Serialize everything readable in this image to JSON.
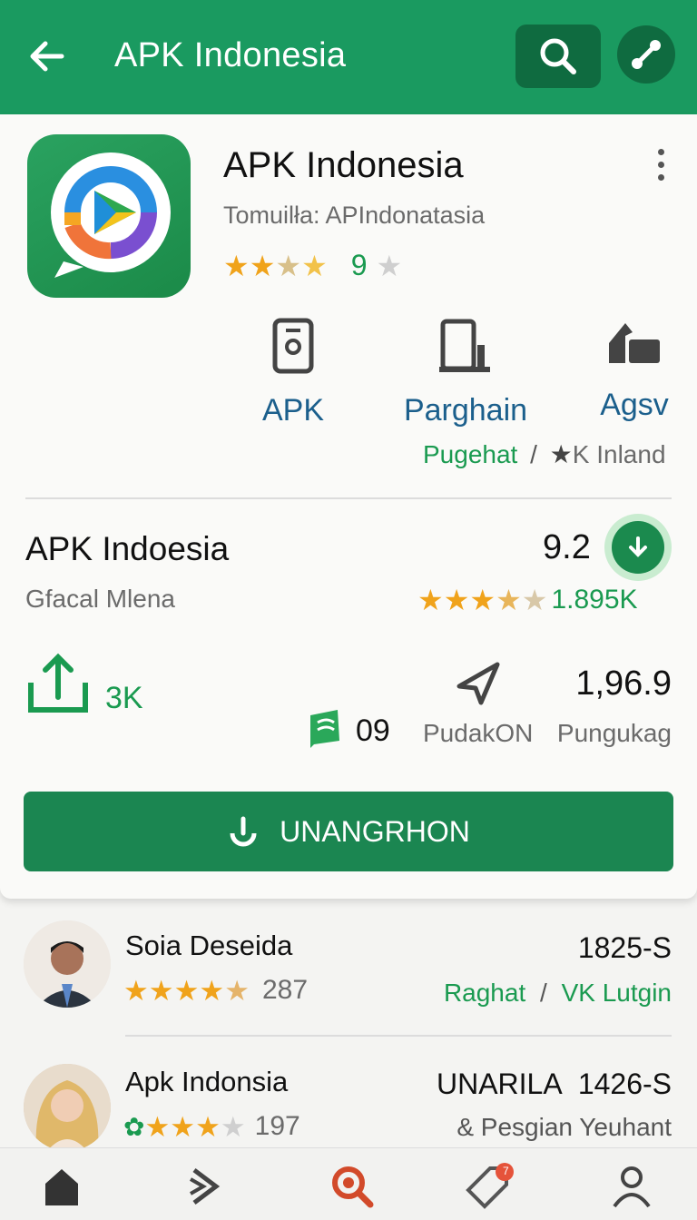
{
  "appbar": {
    "title": "APK Indonesia",
    "accent": "#1a9a60",
    "dark": "#0f6b40",
    "icons": [
      "back-arrow-icon",
      "search-icon",
      "share-icon"
    ]
  },
  "app": {
    "name": "APK Indonesia",
    "subtitle": "Tomuilła: APIndonatasia",
    "rating_count": "9",
    "stars": 2.5
  },
  "features": [
    {
      "label": "APK",
      "icon": "phone-icon"
    },
    {
      "label": "Parghain",
      "icon": "device-icon"
    },
    {
      "label": "Agsv",
      "icon": "hand-icon"
    }
  ],
  "feature_sub": {
    "left": "Pugehat",
    "sep": "/",
    "right": "K Inland"
  },
  "detail": {
    "title": "APK Indoesia",
    "subtitle": "Gfacal Mlena",
    "score": "9.2",
    "reviews": "1.895K",
    "stars": 3.5,
    "shares": "3K",
    "badge_count": "09",
    "stat_value": "1,96.9",
    "stat_label_1": "PudakON",
    "stat_label_2": "Pungukag"
  },
  "install": {
    "label": "UNANGRHON"
  },
  "reviews": [
    {
      "name": "Soia Deseida",
      "count": "287",
      "stars": 4.5,
      "right": "1825-S",
      "sub_left": "Raghat",
      "sub_sep": "/",
      "sub_right": "VK Lutgin"
    },
    {
      "name": "Apk Indonsia",
      "count": "197",
      "stars": 4,
      "right_label": "UNARILA",
      "right": "1426-S",
      "sub": "& Pesgian Yeuhant"
    }
  ],
  "nav": [
    "home-icon",
    "forward-icon",
    "search-icon",
    "tag-icon",
    "profile-icon"
  ],
  "nav_badge": "7"
}
